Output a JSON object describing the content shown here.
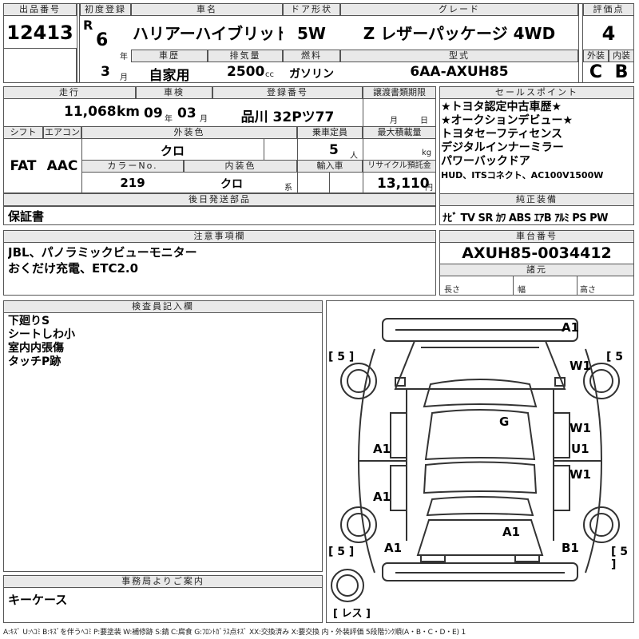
{
  "header": {
    "lot_label": "出品番号",
    "lot_no": "12413",
    "first_reg_label": "初度登録",
    "era": "R",
    "year": "6",
    "year_unit": "年",
    "month": "3",
    "month_unit": "月",
    "name_label": "車名",
    "name": "ハリアーハイブリッド",
    "door_label": "ドア形状",
    "door": "5W",
    "grade_label": "グレード",
    "grade": "Z レザーパッケージ 4WD",
    "score_label": "評価点",
    "score": "4",
    "history_label": "車歴",
    "history": "自家用",
    "displacement_label": "排気量",
    "displacement": "2500",
    "displacement_unit": "cc",
    "fuel_label": "燃料",
    "fuel": "ガソリン",
    "model_label": "型式",
    "model": "6AA-AXUH85",
    "ext_label": "外装",
    "ext_grade": "C",
    "int_label": "内装",
    "int_grade": "B"
  },
  "row2": {
    "mileage_label": "走行",
    "mileage": "11,068",
    "mileage_unit": "km",
    "inspection_label": "車検",
    "insp_year": "09",
    "insp_year_unit": "年",
    "insp_month": "03",
    "insp_month_unit": "月",
    "plate_label": "登録番号",
    "plate": "品川 32Pツ77",
    "transfer_label": "譲渡書類期限",
    "transfer_month_unit": "月",
    "transfer_day_unit": "日",
    "shift_label": "シフト",
    "shift": "FAT",
    "ac_label": "エアコン",
    "ac": "AAC",
    "color_label": "外装色",
    "color": "クロ",
    "capacity_label": "乗車定員",
    "capacity": "5",
    "capacity_unit": "人",
    "load_label": "最大積載量",
    "load_unit": "kg",
    "color_no_label": "カラーNo.",
    "color_no": "219",
    "interior_label": "内装色",
    "interior": "クロ",
    "interior_unit": "系",
    "import_label": "輸入車",
    "recycle_label": "リサイクル預託金",
    "recycle": "13,110",
    "recycle_unit": "円"
  },
  "later_parts": {
    "label": "後日発送部品",
    "value": "保証書"
  },
  "sales_points": {
    "label": "セールスポイント",
    "lines": [
      "★トヨタ認定中古車歴★",
      "★オークションデビュー★",
      "トヨタセーフティセンス",
      "デジタルインナーミラー",
      "パワーバックドア",
      "HUD、ITSコネクト、AC100V1500W"
    ]
  },
  "equipment": {
    "label": "純正装備",
    "value": "ﾅﾋﾞ TV SR ｶﾜ ABS ｴｱB ｱﾙﾐ PS PW"
  },
  "notes": {
    "label": "注意事項欄",
    "lines": [
      "JBL、パノラミックビューモニター",
      "おくだけ充電、ETC2.0"
    ]
  },
  "chassis": {
    "label": "車台番号",
    "value": "AXUH85-0034412"
  },
  "specs": {
    "label": "諸元",
    "length": "長さ",
    "width": "幅",
    "height": "高さ"
  },
  "inspector": {
    "label": "検査員記入欄",
    "lines": [
      "下廻りS",
      "シートしわ小",
      "室内内張傷",
      "タッチP跡"
    ]
  },
  "office": {
    "label": "事務局よりご案内",
    "value": "キーケース"
  },
  "diagram": {
    "marks": [
      "A1",
      "W1",
      "G",
      "W1",
      "U1",
      "W1",
      "A1",
      "A1",
      "A1",
      "A1",
      "B1"
    ],
    "tires": [
      "5",
      "5",
      "5",
      "5"
    ],
    "spare": "レス"
  },
  "legend": "A:ｷｽﾞ U:ﾍｺﾐ B:ｷｽﾞを伴うﾍｺﾐ P:要塗装 W:補修跡 S:錆 C:腐食 G:ﾌﾛﾝﾄｶﾞﾗｽ点ｷｽﾞ XX:交換済み X:要交換 内・外装評価 5段階ﾗﾝｸ順(A・B・C・D・E) 1"
}
